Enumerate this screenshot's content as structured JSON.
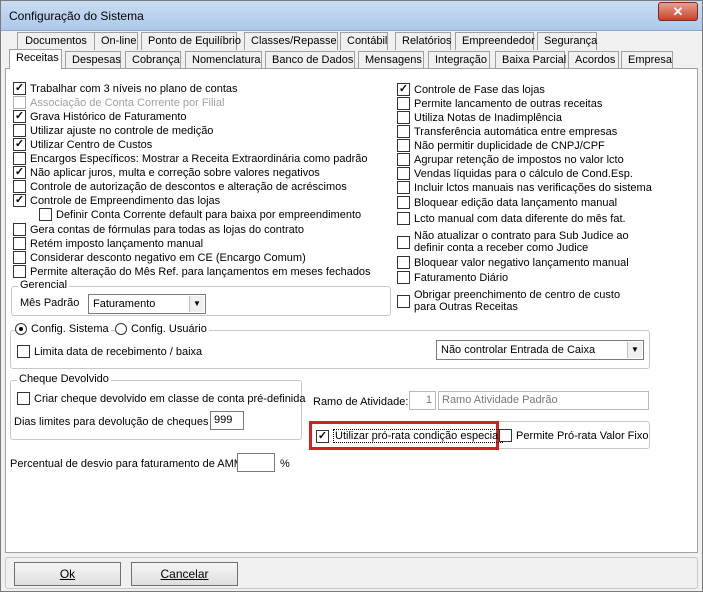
{
  "window": {
    "title": "Configuração do Sistema",
    "close": "✕"
  },
  "tabs_row1": [
    "Documentos",
    "On-line",
    "Ponto de Equilíbrio",
    "Classes/Repasse",
    "Contábil",
    "Relatórios",
    "Empreendedor",
    "Segurança"
  ],
  "tabs_row2": [
    "Receitas",
    "Despesas",
    "Cobrança",
    "Nomenclatura",
    "Banco de Dados",
    "Mensagens",
    "Integração",
    "Baixa Parcial",
    "Acordos",
    "Empresa"
  ],
  "left_checks": [
    {
      "label": "Trabalhar com 3 níveis no plano de contas",
      "checked": true
    },
    {
      "label": "Associação de Conta Corrente por Filial",
      "checked": false,
      "disabled": true
    },
    {
      "label": "Grava Histórico de Faturamento",
      "checked": true
    },
    {
      "label": "Utilizar ajuste no controle de medição",
      "checked": false
    },
    {
      "label": "Utilizar Centro de Custos",
      "checked": true
    },
    {
      "label": "Encargos Específicos: Mostrar a Receita Extraordinária como padrão",
      "checked": false
    },
    {
      "label": "Não aplicar juros, multa e correção sobre valores negativos",
      "checked": true
    },
    {
      "label": "Controle de autorização de descontos e alteração de acréscimos",
      "checked": false
    },
    {
      "label": "Controle de Empreendimento das lojas",
      "checked": true
    },
    {
      "label": "Definir Conta Corrente default para baixa por empreendimento",
      "checked": false
    },
    {
      "label": "Gera contas de fórmulas para todas as lojas do contrato",
      "checked": false
    },
    {
      "label": "Retém imposto lançamento manual",
      "checked": false
    },
    {
      "label": "Considerar desconto negativo em CE (Encargo Comum)",
      "checked": false
    },
    {
      "label": "Permite alteração do Mês Ref. para lançamentos em meses fechados",
      "checked": false
    }
  ],
  "right_checks": [
    {
      "label": "Controle de Fase das lojas",
      "checked": true
    },
    {
      "label": "Permite lancamento de outras receitas",
      "checked": false
    },
    {
      "label": "Utiliza Notas de Inadimplência",
      "checked": false
    },
    {
      "label": "Transferência automática entre empresas",
      "checked": false
    },
    {
      "label": "Não permitir duplicidade de CNPJ/CPF",
      "checked": false
    },
    {
      "label": "Agrupar retenção de impostos no valor lcto",
      "checked": false
    },
    {
      "label": "Vendas líquidas para o cálculo de Cond.Esp.",
      "checked": false
    },
    {
      "label": "Incluir lctos manuais nas verificações do sistema",
      "checked": false
    },
    {
      "label": "Bloquear edição data lançamento manual",
      "checked": false
    },
    {
      "label": "Lcto manual com data diferente do mês fat.",
      "checked": false
    },
    {
      "label": "Não atualizar o contrato para Sub Judice ao definir conta a receber como Judice",
      "checked": false
    },
    {
      "label": "Bloquear valor negativo lançamento manual",
      "checked": false
    },
    {
      "label": "Faturamento Diário",
      "checked": false
    },
    {
      "label": "Obrigar preenchimento de centro de custo para Outras Receitas",
      "checked": false
    }
  ],
  "gerencial": {
    "legend": "Gerencial",
    "label": "Mês Padrão",
    "value": "Faturamento"
  },
  "config": {
    "radio1": "Config. Sistema",
    "radio2": "Config. Usuário",
    "limit_label": "Limita data de recebimento / baixa",
    "caixa_value": "Não controlar Entrada de Caixa"
  },
  "cheque": {
    "legend": "Cheque Devolvido",
    "check_label": "Criar cheque devolvido em classe de conta pré-definida",
    "days_label": "Dias limites para devolução de cheques",
    "days_value": "999"
  },
  "ramo": {
    "label": "Ramo de Atividade:",
    "code": "1",
    "name": "Ramo Atividade Padrão"
  },
  "prorata": {
    "label": "Utilizar pró-rata condição especial",
    "checked": true,
    "fixo_label": "Permite Pró-rata Valor Fixo"
  },
  "desvio": {
    "label": "Percentual de desvio para faturamento de AMM",
    "unit": "%",
    "value": ""
  },
  "buttons": {
    "ok": "Ok",
    "cancel": "Cancelar"
  },
  "colors": {
    "highlight": "#d21f1f"
  }
}
